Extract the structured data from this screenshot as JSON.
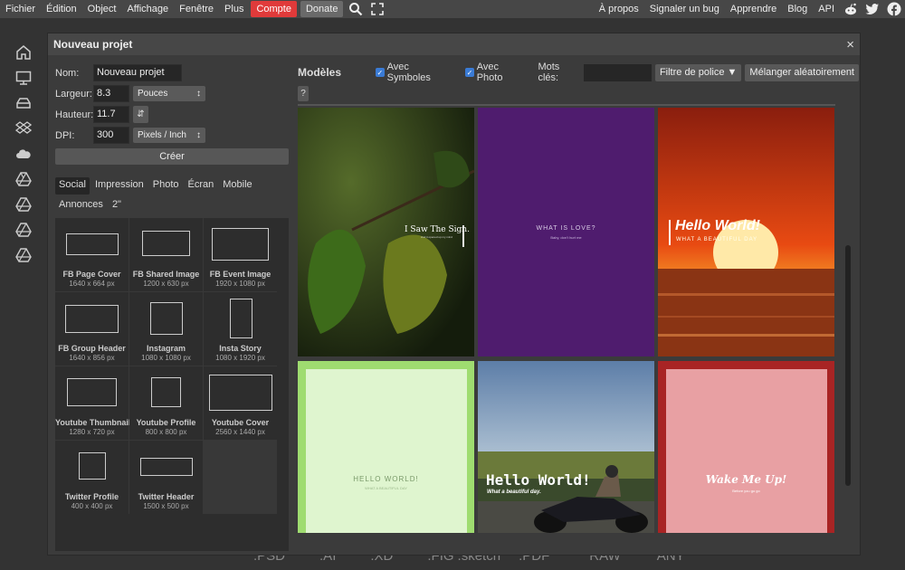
{
  "menu": {
    "items": [
      "Fichier",
      "Édition",
      "Object",
      "Affichage",
      "Fenêtre",
      "Plus"
    ],
    "account": "Compte",
    "donate": "Donate",
    "right": [
      "À propos",
      "Signaler un bug",
      "Apprendre",
      "Blog",
      "API"
    ]
  },
  "bottom_formats": [
    ".PSD",
    ".AI",
    ".XD",
    ".FIG",
    ".sketch",
    ".PDF",
    "RAW",
    "ANY"
  ],
  "dialog": {
    "title": "Nouveau projet",
    "close": "×",
    "name_label": "Nom:",
    "name_value": "Nouveau projet",
    "width_label": "Largeur:",
    "width_value": "8.3",
    "width_unit": "Pouces",
    "height_label": "Hauteur:",
    "height_value": "11.7",
    "dpi_label": "DPI:",
    "dpi_value": "300",
    "dpi_unit": "Pixels / Inch",
    "create": "Créer",
    "tabs": [
      "Social",
      "Impression",
      "Photo",
      "Écran",
      "Mobile",
      "Annonces",
      "2\""
    ],
    "active_tab": "Social",
    "presets": [
      {
        "name": "FB Page Cover",
        "size": "1640 x 664 px"
      },
      {
        "name": "FB Shared Image",
        "size": "1200 x 630 px"
      },
      {
        "name": "FB Event Image",
        "size": "1920 x 1080 px"
      },
      {
        "name": "FB Group Header",
        "size": "1640 x 856 px"
      },
      {
        "name": "Instagram",
        "size": "1080 x 1080 px"
      },
      {
        "name": "Insta Story",
        "size": "1080 x 1920 px"
      },
      {
        "name": "Youtube Thumbnail",
        "size": "1280 x 720 px"
      },
      {
        "name": "Youtube Profile",
        "size": "800 x 800 px"
      },
      {
        "name": "Youtube Cover",
        "size": "2560 x 1440 px"
      },
      {
        "name": "Twitter Profile",
        "size": "400 x 400 px"
      },
      {
        "name": "Twitter Header",
        "size": "1500 x 500 px"
      }
    ],
    "templates_title": "Modèles",
    "avec_symboles": "Avec Symboles",
    "avec_photo": "Avec Photo",
    "mots_cles": "Mots clés:",
    "filtre": "Filtre de police ▼",
    "melanger": "Mélanger aléatoirement",
    "help": "?",
    "templates": [
      {
        "title": "I Saw The Sign.",
        "sub": "And it opened up my mind"
      },
      {
        "title": "WHAT IS LOVE?",
        "sub": "Baby, don't hurt me"
      },
      {
        "title": "Hello World!",
        "sub": "WHAT A BEAUTIFUL DAY"
      },
      {
        "title": "HELLO WORLD!",
        "sub": "WHAT A BEAUTIFUL DAY"
      },
      {
        "title": "Hello World!",
        "sub": "What a beautiful day."
      },
      {
        "title": "Wake Me Up!",
        "sub": "Before you go go"
      }
    ]
  },
  "colors": {
    "accent": "#e03a3a",
    "checkbox": "#3a7bd5",
    "purple": "#4f1c6e",
    "pink": "#e8a0a3",
    "lightgreen": "#dff5cf"
  }
}
